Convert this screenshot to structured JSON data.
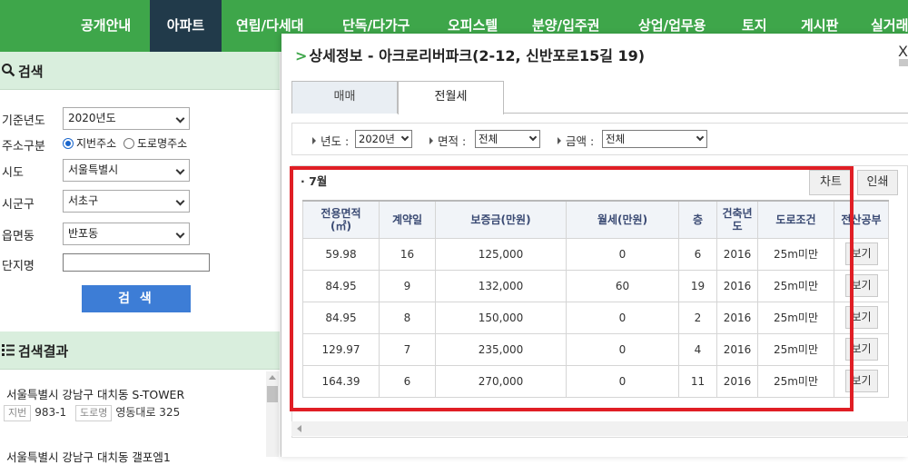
{
  "nav": {
    "items": [
      "공개안내",
      "아파트",
      "연립/다세대",
      "단독/다가구",
      "오피스텔",
      "분양/입주권",
      "상업/업무용",
      "토지",
      "게시판",
      "실거래"
    ],
    "active_index": 1
  },
  "search": {
    "title": "검색",
    "fields": {
      "year_label": "기준년도",
      "year_value": "2020년도",
      "addr_type_label": "주소구분",
      "addr_options": [
        "지번주소",
        "도로명주소"
      ],
      "addr_selected": "지번주소",
      "sido_label": "시도",
      "sido_value": "서울특별시",
      "sigungu_label": "시군구",
      "sigungu_value": "서초구",
      "dong_label": "읍면동",
      "dong_value": "반포동",
      "complex_label": "단지명",
      "complex_value": ""
    },
    "button": "검 색"
  },
  "results": {
    "title": "검색결과",
    "items": [
      {
        "name": "서울특별시 강남구 대치동 S-TOWER",
        "jibun_tag": "지번",
        "jibun": "983-1",
        "road_tag": "도로명",
        "road": "영동대로 325"
      },
      {
        "name": "서울특별시 강남구 대치동 갤포엠1"
      }
    ]
  },
  "modal": {
    "title": "상세정보 - 아크로리버파크(2-12, 신반포로15길 19)",
    "close": "X",
    "tabs": [
      "매매",
      "전월세"
    ],
    "active_tab": 1,
    "filters": {
      "year_label": "년도 :",
      "year_value": "2020년",
      "area_label": "면적 :",
      "area_value": "전체",
      "amount_label": "금액 :",
      "amount_value": "전체"
    },
    "month": "· 7월",
    "chart_button": "차트",
    "print_button": "인쇄",
    "table": {
      "headers": [
        "전용면적\n(㎡)",
        "계약일",
        "보증금(만원)",
        "월세(만원)",
        "층",
        "건축년도",
        "도로조건",
        "전산공부"
      ],
      "rows": [
        [
          "59.98",
          "16",
          "125,000",
          "0",
          "6",
          "2016",
          "25m미만",
          "보기"
        ],
        [
          "84.95",
          "9",
          "132,000",
          "60",
          "19",
          "2016",
          "25m미만",
          "보기"
        ],
        [
          "84.95",
          "8",
          "150,000",
          "0",
          "2",
          "2016",
          "25m미만",
          "보기"
        ],
        [
          "129.97",
          "7",
          "235,000",
          "0",
          "4",
          "2016",
          "25m미만",
          "보기"
        ],
        [
          "164.39",
          "6",
          "270,000",
          "0",
          "11",
          "2016",
          "25m미만",
          "보기"
        ]
      ]
    }
  },
  "colors": {
    "nav_green": "#3ea64a",
    "nav_active": "#213a4a",
    "search_button": "#3d7dd6",
    "highlight_red": "#e01e25",
    "header_text": "#3a4a73"
  }
}
